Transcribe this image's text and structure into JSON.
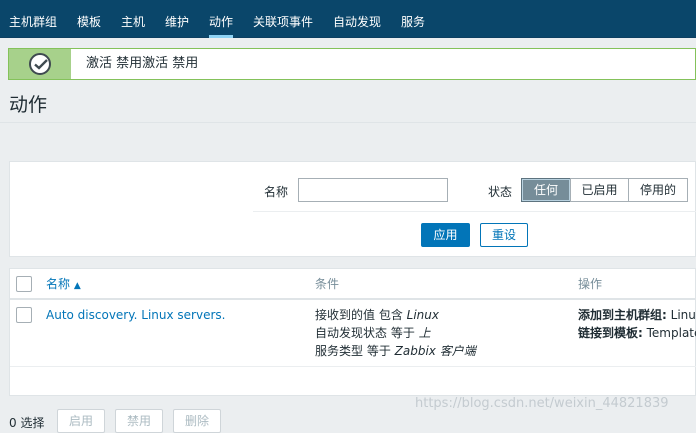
{
  "nav": {
    "items": [
      "主机群组",
      "模板",
      "主机",
      "维护",
      "动作",
      "关联项事件",
      "自动发现",
      "服务"
    ],
    "active_index": 4
  },
  "message": {
    "text": "激活 禁用激活 禁用",
    "status_color": "#84c25a"
  },
  "page": {
    "title": "动作"
  },
  "filter": {
    "name_label": "名称",
    "name_value": "",
    "status_label": "状态",
    "status_options": [
      "任何",
      "已启用",
      "停用的"
    ],
    "status_selected": "任何",
    "apply_label": "应用",
    "reset_label": "重设"
  },
  "table": {
    "headers": {
      "name": "名称",
      "sort_indicator": "▲",
      "conditions": "条件",
      "operations": "操作"
    },
    "rows": [
      {
        "name": "Auto discovery. Linux servers.",
        "conditions": [
          {
            "prefix": "接收到的值 包含 ",
            "value": "Linux"
          },
          {
            "prefix": "自动发现状态 等于 ",
            "value": "上"
          },
          {
            "prefix": "服务类型 等于 ",
            "value": "Zabbix 客户端"
          }
        ],
        "operations": [
          {
            "label": "添加到主机群组:",
            "value": " Linu"
          },
          {
            "label": "链接到模板:",
            "value": " Template"
          }
        ]
      }
    ]
  },
  "footer": {
    "selected_count": "0 选择",
    "buttons": [
      "启用",
      "禁用",
      "删除"
    ]
  },
  "watermark": "https://blog.csdn.net/weixin_44821839",
  "colors": {
    "nav_bg": "#0a466a",
    "link": "#0275b8",
    "success": "#84c25a"
  }
}
